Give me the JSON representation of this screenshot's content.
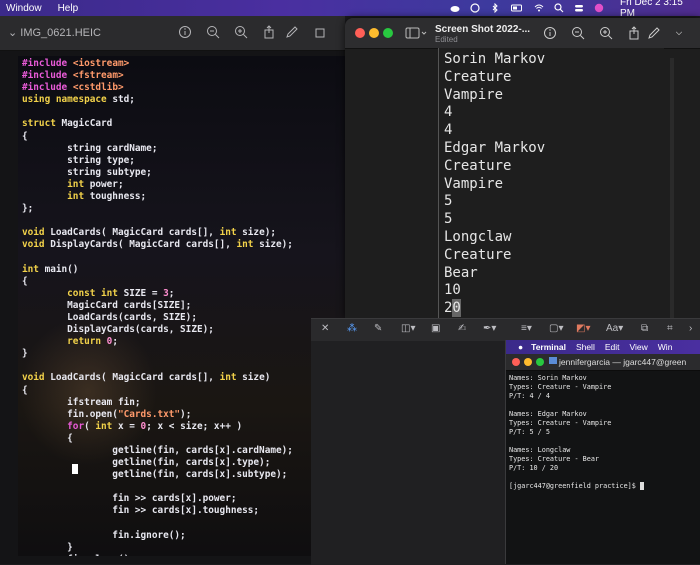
{
  "menubar": {
    "items": [
      "Window",
      "Help"
    ],
    "datetime": "Fri Dec 2  3:15 PM"
  },
  "photo_window": {
    "title": "IMG_0621.HEIC",
    "code_lines": [
      [
        {
          "t": "#include ",
          "c": "kw"
        },
        {
          "t": "<iostream>",
          "c": "str"
        }
      ],
      [
        {
          "t": "#include ",
          "c": "kw"
        },
        {
          "t": "<fstream>",
          "c": "str"
        }
      ],
      [
        {
          "t": "#include ",
          "c": "kw"
        },
        {
          "t": "<cstdlib>",
          "c": "str"
        }
      ],
      [
        {
          "t": "using namespace ",
          "c": "typ"
        },
        {
          "t": "std;",
          "c": ""
        }
      ],
      [],
      [
        {
          "t": "struct ",
          "c": "typ"
        },
        {
          "t": "MagicCard",
          "c": ""
        }
      ],
      [
        {
          "t": "{",
          "c": ""
        }
      ],
      [
        {
          "t": "        string cardName;",
          "c": ""
        }
      ],
      [
        {
          "t": "        string type;",
          "c": ""
        }
      ],
      [
        {
          "t": "        string subtype;",
          "c": ""
        }
      ],
      [
        {
          "t": "        ",
          "c": ""
        },
        {
          "t": "int ",
          "c": "typ"
        },
        {
          "t": "power;",
          "c": ""
        }
      ],
      [
        {
          "t": "        ",
          "c": ""
        },
        {
          "t": "int ",
          "c": "typ"
        },
        {
          "t": "toughness;",
          "c": ""
        }
      ],
      [
        {
          "t": "};",
          "c": ""
        }
      ],
      [],
      [
        {
          "t": "void ",
          "c": "typ"
        },
        {
          "t": "LoadCards( MagicCard cards[], ",
          "c": ""
        },
        {
          "t": "int ",
          "c": "typ"
        },
        {
          "t": "size);",
          "c": ""
        }
      ],
      [
        {
          "t": "void ",
          "c": "typ"
        },
        {
          "t": "DisplayCards( MagicCard cards[], ",
          "c": ""
        },
        {
          "t": "int ",
          "c": "typ"
        },
        {
          "t": "size);",
          "c": ""
        }
      ],
      [],
      [
        {
          "t": "int ",
          "c": "typ"
        },
        {
          "t": "main()",
          "c": ""
        }
      ],
      [
        {
          "t": "{",
          "c": ""
        }
      ],
      [
        {
          "t": "        ",
          "c": ""
        },
        {
          "t": "const int ",
          "c": "typ"
        },
        {
          "t": "SIZE = ",
          "c": ""
        },
        {
          "t": "3",
          "c": "num"
        },
        {
          "t": ";",
          "c": ""
        }
      ],
      [
        {
          "t": "        MagicCard cards[SIZE];",
          "c": ""
        }
      ],
      [
        {
          "t": "        LoadCards(cards, SIZE);",
          "c": ""
        }
      ],
      [
        {
          "t": "        DisplayCards(cards, SIZE);",
          "c": ""
        }
      ],
      [
        {
          "t": "        ",
          "c": ""
        },
        {
          "t": "return ",
          "c": "typ"
        },
        {
          "t": "0",
          "c": "num"
        },
        {
          "t": ";",
          "c": ""
        }
      ],
      [
        {
          "t": "}",
          "c": ""
        }
      ],
      [],
      [
        {
          "t": "void ",
          "c": "typ"
        },
        {
          "t": "LoadCards( MagicCard cards[], ",
          "c": ""
        },
        {
          "t": "int ",
          "c": "typ"
        },
        {
          "t": "size)",
          "c": ""
        }
      ],
      [
        {
          "t": "{",
          "c": ""
        }
      ],
      [
        {
          "t": "        ifstream fin;",
          "c": ""
        }
      ],
      [
        {
          "t": "        fin.open(",
          "c": ""
        },
        {
          "t": "\"Cards.txt\"",
          "c": "str"
        },
        {
          "t": ");",
          "c": ""
        }
      ],
      [
        {
          "t": "        ",
          "c": ""
        },
        {
          "t": "for",
          "c": "kw"
        },
        {
          "t": "( ",
          "c": ""
        },
        {
          "t": "int ",
          "c": "typ"
        },
        {
          "t": "x = ",
          "c": ""
        },
        {
          "t": "0",
          "c": "num"
        },
        {
          "t": "; x < size; x++ )",
          "c": ""
        }
      ],
      [
        {
          "t": "        {",
          "c": ""
        }
      ],
      [
        {
          "t": "                getline(fin, cards[x].cardName);",
          "c": ""
        }
      ],
      [
        {
          "t": "                getline(fin, cards[x].type);",
          "c": ""
        }
      ],
      [
        {
          "t": "                getline(fin, cards[x].subtype);",
          "c": ""
        }
      ],
      [],
      [
        {
          "t": "                fin >> cards[x].power;",
          "c": ""
        }
      ],
      [
        {
          "t": "                fin >> cards[x].toughness;",
          "c": ""
        }
      ],
      [],
      [
        {
          "t": "                fin.ignore();",
          "c": ""
        }
      ],
      [
        {
          "t": "        }",
          "c": ""
        }
      ],
      [
        {
          "t": "        fin.close();",
          "c": ""
        }
      ]
    ]
  },
  "screenshot_window": {
    "title": "Screen Shot 2022-...",
    "subtitle": "Edited",
    "lines": [
      "Sorin Markov",
      "Creature",
      "Vampire",
      "4",
      "4",
      "Edgar Markov",
      "Creature",
      "Vampire",
      "5",
      "5",
      "Longclaw",
      "Creature",
      "Bear",
      "10",
      "20"
    ]
  },
  "markup_toolbar": {
    "font_label": "Aa"
  },
  "terminal": {
    "menu": [
      "Terminal",
      "Shell",
      "Edit",
      "View",
      "Win"
    ],
    "title": "jennifergarcia — jgarc447@green",
    "lines": [
      "Names: Sorin Markov",
      "Types: Creature - Vampire",
      "P/T: 4 / 4",
      "",
      "Names: Edgar Markov",
      "Types: Creature - Vampire",
      "P/T: 5 / 5",
      "",
      "Names: Longclaw",
      "Types: Creature - Bear",
      "P/T: 10 / 20",
      "",
      "[jgarc447@greenfield practice]$ "
    ]
  },
  "colors": {
    "menubar": "#3b2a8a",
    "close": "#ff5f57",
    "minimize": "#febc2e",
    "zoom": "#28c840"
  }
}
